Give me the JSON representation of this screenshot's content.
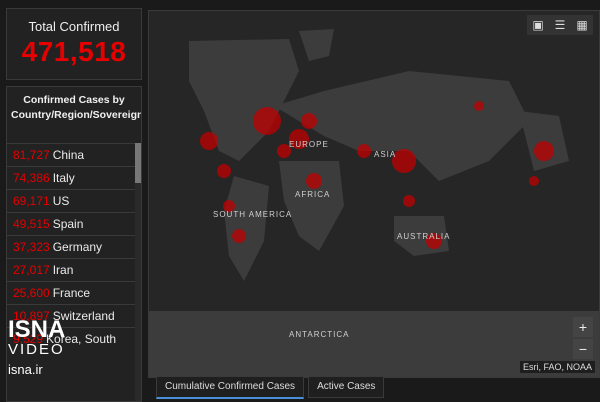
{
  "total": {
    "label": "Total Confirmed",
    "value": "471,518"
  },
  "list": {
    "header": "Confirmed Cases by Country/Region/Sovereignty",
    "rows": [
      {
        "count": "81,727",
        "name": "China"
      },
      {
        "count": "74,386",
        "name": "Italy"
      },
      {
        "count": "69,171",
        "name": "US"
      },
      {
        "count": "49,515",
        "name": "Spain"
      },
      {
        "count": "37,323",
        "name": "Germany"
      },
      {
        "count": "27,017",
        "name": "Iran"
      },
      {
        "count": "25,600",
        "name": "France"
      },
      {
        "count": "10,897",
        "name": "Switzerland"
      },
      {
        "count": "9,529",
        "name": "Korea, South"
      }
    ]
  },
  "map": {
    "labels": [
      "EUROPE",
      "ASIA",
      "AFRICA",
      "SOUTH AMERICA",
      "AUSTRALIA",
      "ANTARCTICA"
    ],
    "attribution": "Esri, FAO, NOAA",
    "zoom_in": "+",
    "zoom_out": "−",
    "tools": [
      "bookmark-icon",
      "list-icon",
      "qr-icon"
    ]
  },
  "tabs": [
    "Cumulative Confirmed Cases",
    "Active Cases"
  ],
  "watermark": {
    "brand": "ISNA",
    "sub": "VIDEO",
    "url": "isna.ir"
  },
  "colors": {
    "accent": "#e60000",
    "background": "#1a1a1a",
    "land": "#3c3c3c",
    "ocean": "#262626"
  }
}
